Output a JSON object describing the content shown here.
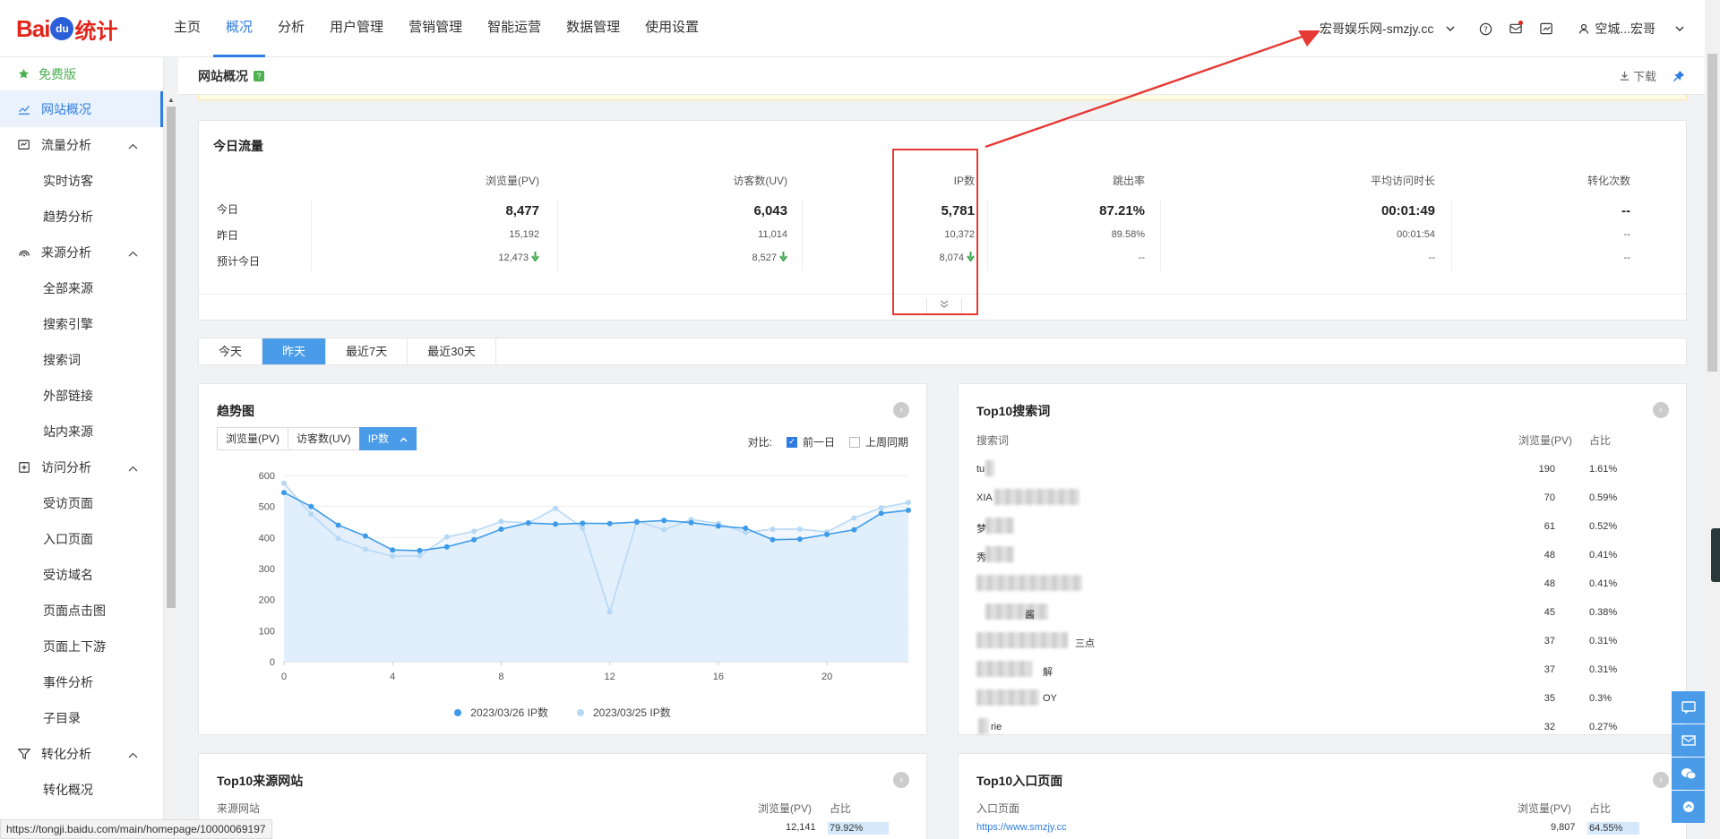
{
  "brand": {
    "bai": "Bai",
    "du": "du",
    "stat": "统计"
  },
  "nav": [
    "主页",
    "概况",
    "分析",
    "用户管理",
    "营销管理",
    "智能运营",
    "数据管理",
    "使用设置"
  ],
  "nav_active": 1,
  "site": {
    "name": "宏哥娱乐网-smzjy.cc"
  },
  "user": {
    "name": "空城...宏哥"
  },
  "sidebar": {
    "plan": "免费版",
    "items": [
      {
        "label": "网站概况",
        "type": "top",
        "icon": "line-chart-icon",
        "active": true
      },
      {
        "label": "流量分析",
        "type": "group",
        "icon": "traffic-icon"
      },
      {
        "label": "实时访客",
        "type": "sub"
      },
      {
        "label": "趋势分析",
        "type": "sub"
      },
      {
        "label": "来源分析",
        "type": "group",
        "icon": "source-icon"
      },
      {
        "label": "全部来源",
        "type": "sub"
      },
      {
        "label": "搜索引擎",
        "type": "sub"
      },
      {
        "label": "搜索词",
        "type": "sub"
      },
      {
        "label": "外部链接",
        "type": "sub"
      },
      {
        "label": "站内来源",
        "type": "sub"
      },
      {
        "label": "访问分析",
        "type": "group",
        "icon": "visit-icon"
      },
      {
        "label": "受访页面",
        "type": "sub"
      },
      {
        "label": "入口页面",
        "type": "sub"
      },
      {
        "label": "受访域名",
        "type": "sub"
      },
      {
        "label": "页面点击图",
        "type": "sub"
      },
      {
        "label": "页面上下游",
        "type": "sub"
      },
      {
        "label": "事件分析",
        "type": "sub"
      },
      {
        "label": "子目录",
        "type": "sub"
      },
      {
        "label": "转化分析",
        "type": "group",
        "icon": "funnel-icon"
      },
      {
        "label": "转化概况",
        "type": "sub"
      }
    ]
  },
  "subheader": {
    "title": "网站概况",
    "help": "?",
    "download": "下载"
  },
  "traffic": {
    "title": "今日流量",
    "row_labels": [
      "今日",
      "昨日",
      "预计今日"
    ],
    "columns": [
      {
        "head": "浏览量(PV)",
        "today": "8,477",
        "yesterday": "15,192",
        "forecast": "12,473",
        "down": true
      },
      {
        "head": "访客数(UV)",
        "today": "6,043",
        "yesterday": "11,014",
        "forecast": "8,527",
        "down": true
      },
      {
        "head": "IP数",
        "today": "5,781",
        "yesterday": "10,372",
        "forecast": "8,074",
        "down": true
      },
      {
        "head": "跳出率",
        "today": "87.21%",
        "yesterday": "89.58%",
        "forecast": "--",
        "down": false
      },
      {
        "head": "平均访问时长",
        "today": "00:01:49",
        "yesterday": "00:01:54",
        "forecast": "--",
        "down": false
      },
      {
        "head": "转化次数",
        "today": "--",
        "yesterday": "--",
        "forecast": "--",
        "down": false
      }
    ]
  },
  "date_tabs": [
    "今天",
    "昨天",
    "最近7天",
    "最近30天"
  ],
  "date_tab_active": 1,
  "trend": {
    "title": "趋势图",
    "metrics": [
      "浏览量(PV)",
      "访客数(UV)",
      "IP数"
    ],
    "metric_active": 2,
    "compare_label": "对比:",
    "compare_options": [
      {
        "label": "前一日",
        "checked": true
      },
      {
        "label": "上周同期",
        "checked": false
      }
    ]
  },
  "chart_data": {
    "type": "area",
    "x": [
      0,
      1,
      2,
      3,
      4,
      5,
      6,
      7,
      8,
      9,
      10,
      11,
      12,
      13,
      14,
      15,
      16,
      17,
      18,
      19,
      20,
      21,
      22,
      23
    ],
    "xticks": [
      0,
      4,
      8,
      12,
      16,
      20
    ],
    "yticks": [
      0,
      100,
      200,
      300,
      400,
      500,
      600
    ],
    "ylim": [
      0,
      600
    ],
    "xlim": [
      0,
      23
    ],
    "grid": true,
    "legend_position": "bottom",
    "series": [
      {
        "name": "2023/03/26 IP数",
        "color": "#3d9be9",
        "values": [
          545,
          500,
          440,
          405,
          360,
          358,
          370,
          393,
          427,
          447,
          443,
          446,
          445,
          450,
          455,
          448,
          437,
          430,
          393,
          395,
          410,
          425,
          478,
          488
        ]
      },
      {
        "name": "2023/03/25 IP数",
        "color": "#b7d8f5",
        "values": [
          575,
          475,
          397,
          362,
          340,
          341,
          402,
          420,
          452,
          447,
          494,
          431,
          160,
          453,
          425,
          458,
          445,
          416,
          427,
          427,
          418,
          463,
          496,
          513
        ]
      }
    ]
  },
  "top10_search": {
    "title": "Top10搜索词",
    "headers": [
      "搜索词",
      "浏览量(PV)",
      "占比"
    ],
    "rows": [
      {
        "kw": "tu",
        "pv": "190",
        "pct": "1.61%"
      },
      {
        "kw": "XIA",
        "pv": "70",
        "pct": "0.59%"
      },
      {
        "kw": "梦",
        "pv": "61",
        "pct": "0.52%"
      },
      {
        "kw": "秀",
        "pv": "48",
        "pct": "0.41%"
      },
      {
        "kw": "",
        "pv": "48",
        "pct": "0.41%"
      },
      {
        "kw": "酱",
        "pv": "45",
        "pct": "0.38%"
      },
      {
        "kw": "三点",
        "pv": "37",
        "pct": "0.31%"
      },
      {
        "kw": "解",
        "pv": "37",
        "pct": "0.31%"
      },
      {
        "kw": "OY",
        "pv": "35",
        "pct": "0.3%"
      },
      {
        "kw": "rie",
        "pv": "32",
        "pct": "0.27%"
      }
    ]
  },
  "top10_site": {
    "title": "Top10来源网站",
    "headers": [
      "来源网站",
      "浏览量(PV)",
      "占比"
    ],
    "row": {
      "pv": "12,141",
      "pct": "79.92%"
    }
  },
  "top10_entry": {
    "title": "Top10入口页面",
    "headers": [
      "入口页面",
      "浏览量(PV)",
      "占比"
    ],
    "row": {
      "url": "https://www.smzjy.cc",
      "pv": "9,807",
      "pct": "64.55%"
    }
  },
  "status_url": "https://tongji.baidu.com/main/homepage/10000069197"
}
